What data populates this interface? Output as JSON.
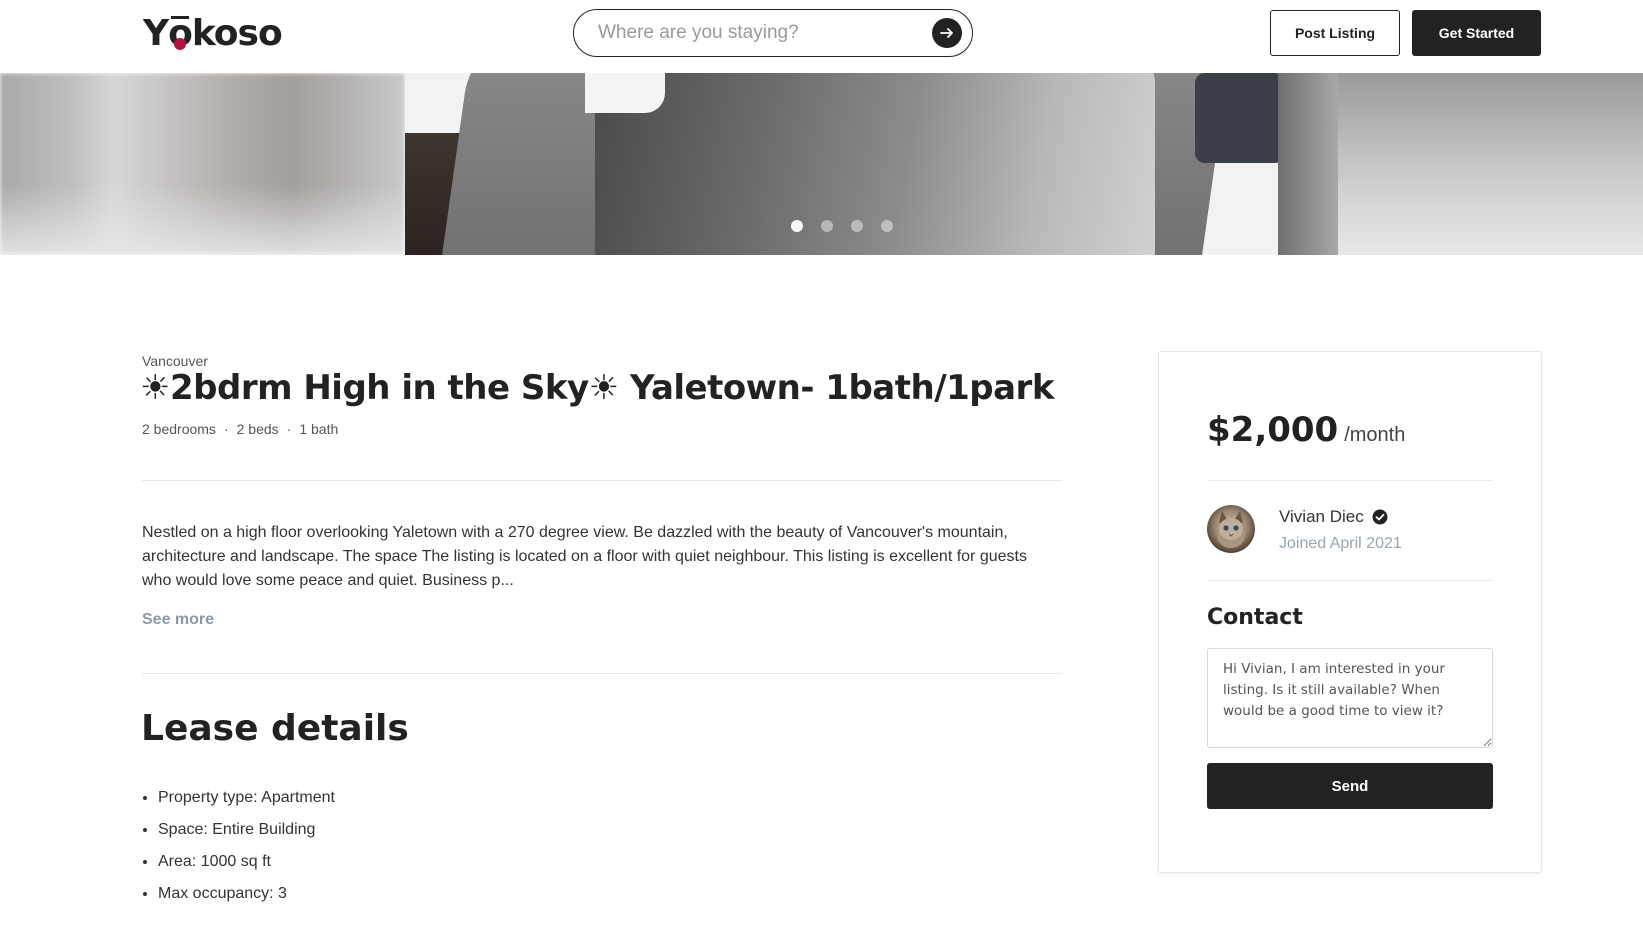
{
  "header": {
    "logo_text": "Yōkoso",
    "logo_prefix": "Y",
    "logo_mark_letter": "o",
    "logo_suffix": "koso",
    "search_placeholder": "Where are you staying?",
    "post_listing_label": "Post Listing",
    "get_started_label": "Get Started"
  },
  "gallery": {
    "slide_count": 4,
    "active_slide": 1
  },
  "listing": {
    "city": "Vancouver",
    "title": "☀2bdrm High in the Sky☀ Yaletown- 1bath/1park",
    "meta": {
      "bedrooms": "2 bedrooms",
      "beds": "2 beds",
      "baths": "1 bath",
      "separator": "·"
    },
    "description": "Nestled on a high floor overlooking Yaletown with a 270 degree view. Be dazzled with the beauty of Vancouver's mountain, architecture and landscape. The space The listing is located on a floor with quiet neighbour. This listing is excellent for guests who would love some peace and quiet. Business p...",
    "see_more_label": "See more",
    "lease_title": "Lease details",
    "lease_items": [
      "Property type: Apartment",
      "Space: Entire Building",
      "Area: 1000 sq ft",
      "Max occupancy: 3"
    ]
  },
  "card": {
    "price": "$2,000",
    "per": "/month",
    "host_name": "Vivian Diec",
    "host_joined": "Joined April 2021",
    "contact_title": "Contact",
    "message": "Hi Vivian, I am interested in your listing. Is it still available? When would be a good time to view it?",
    "send_label": "Send"
  },
  "colors": {
    "brand_dark": "#222222",
    "logo_accent": "#b3123a",
    "muted_link": "#8d99a8",
    "muted_text": "#9aa5b1"
  }
}
